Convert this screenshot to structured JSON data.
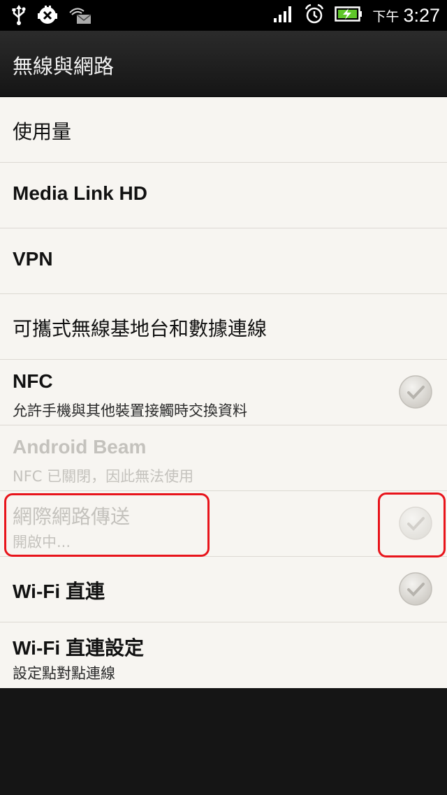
{
  "status_bar": {
    "ampm": "下午",
    "time": "3:27",
    "icons_left": [
      "usb-icon",
      "android-debug-icon",
      "notification-icon"
    ],
    "icons_right": [
      "signal-icon",
      "alarm-icon",
      "battery-charging-icon"
    ]
  },
  "title_bar": {
    "title": "無線與網路"
  },
  "items": [
    {
      "title": "使用量"
    },
    {
      "title": "Media Link HD"
    },
    {
      "title": "VPN"
    },
    {
      "title": "可攜式無線基地台和數據連線"
    },
    {
      "title": "NFC",
      "subtitle": "允許手機與其他裝置接觸時交換資料"
    },
    {
      "title": "Android Beam",
      "subtitle": "NFC 已關閉，因此無法使用"
    },
    {
      "title": "網際網路傳送",
      "subtitle": "開啟中..."
    },
    {
      "title": "Wi-Fi 直連"
    },
    {
      "title": "Wi-Fi 直連設定",
      "subtitle": "設定點對點連線"
    }
  ],
  "colors": {
    "list_background": "#f7f5f1",
    "highlight": "#e8141b",
    "disabled_text": "#c4c2bd"
  }
}
